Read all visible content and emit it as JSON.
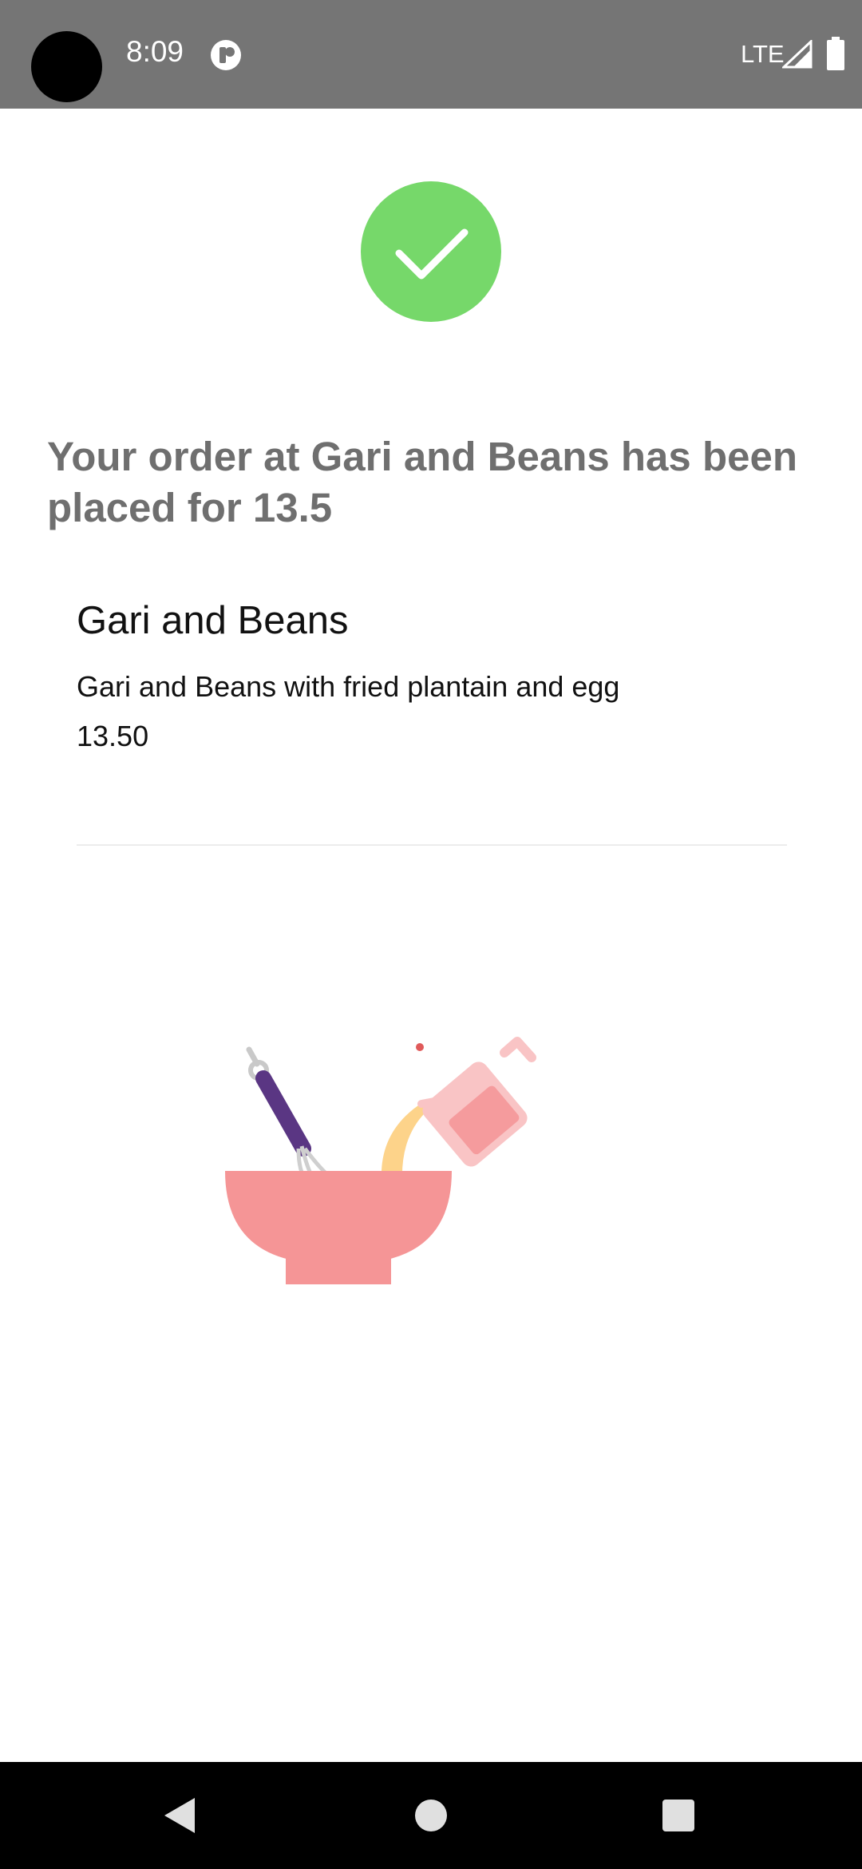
{
  "status_bar": {
    "time": "8:09",
    "network": "LTE",
    "icons": [
      "notification-icon",
      "signal-icon",
      "battery-icon"
    ]
  },
  "success": {
    "icon": "check-icon",
    "color": "#76d86a"
  },
  "confirmation": {
    "message": "Your order at Gari and Beans has been placed for 13.5"
  },
  "order_item": {
    "name": "Gari and Beans",
    "description": "Gari and Beans with fried plantain and egg",
    "price": "13.50"
  },
  "illustration": {
    "icon": "cooking-bowl-illustration"
  },
  "nav_bar": {
    "icons": [
      "back-icon",
      "home-icon",
      "recents-icon"
    ]
  }
}
